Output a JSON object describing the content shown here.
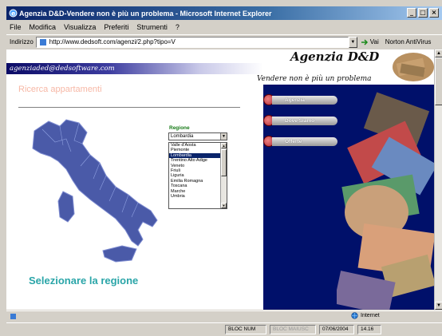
{
  "window": {
    "title": "Agenzia D&D-Vendere non è più un problema - Microsoft Internet Explorer",
    "controls": [
      "_",
      "□",
      "×"
    ]
  },
  "menu": [
    "File",
    "Modifica",
    "Visualizza",
    "Preferiti",
    "Strumenti",
    "?"
  ],
  "address": {
    "label": "Indirizzo",
    "url": "http://www.dedsoft.com/agenzi/2.php?tipo=V",
    "go_label": "Vai",
    "norton_label": "Norton AntiVirus"
  },
  "page": {
    "email": "agenziaded@dedsoftware.com",
    "subtitle": "Ricerca appartamenti",
    "cta": "Selezionare la regione",
    "region_label": "Regione",
    "region_selected": "Lombardia",
    "regions": [
      "Valle d'Aosta",
      "Piemonte",
      "Lombardia",
      "Trentino Alto Adige",
      "Veneto",
      "Friuli",
      "Liguria",
      "Emilia Romagna",
      "Toscana",
      "Marche",
      "Umbria"
    ],
    "brand": "Agenzia D&D",
    "tagline": "Vendere non è più un problema",
    "nav": [
      "Agenzia",
      "Dove Siamo",
      "Offerte"
    ]
  },
  "status": {
    "zone": "Internet",
    "caps1": "BLOC NUM",
    "caps2": "BLOC MAIUSC",
    "date": "07/06/2004",
    "time": "14.16"
  },
  "colors": {
    "panel_bg": "#00106a",
    "cta": "#2aa5a8",
    "subtitle": "#f7b8a6",
    "region_label": "#177a17"
  }
}
